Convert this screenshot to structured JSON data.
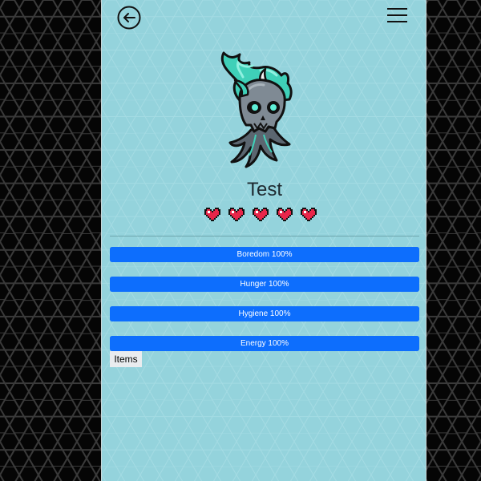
{
  "app": {
    "pet_name": "Test",
    "lives": 5,
    "accent_color": "#0d6efd",
    "screen_background": "#94d3dc"
  },
  "header": {
    "back_icon": "arrow-left-circle-icon",
    "menu_icon": "hamburger-menu-icon"
  },
  "character": {
    "icon": "ghost-spirit-creature"
  },
  "stats": [
    {
      "label": "Boredom 100%",
      "value": 100
    },
    {
      "label": "Hunger 100%",
      "value": 100
    },
    {
      "label": "Hygiene 100%",
      "value": 100
    },
    {
      "label": "Energy 100%",
      "value": 100
    }
  ],
  "items_button": {
    "label": "Items"
  }
}
